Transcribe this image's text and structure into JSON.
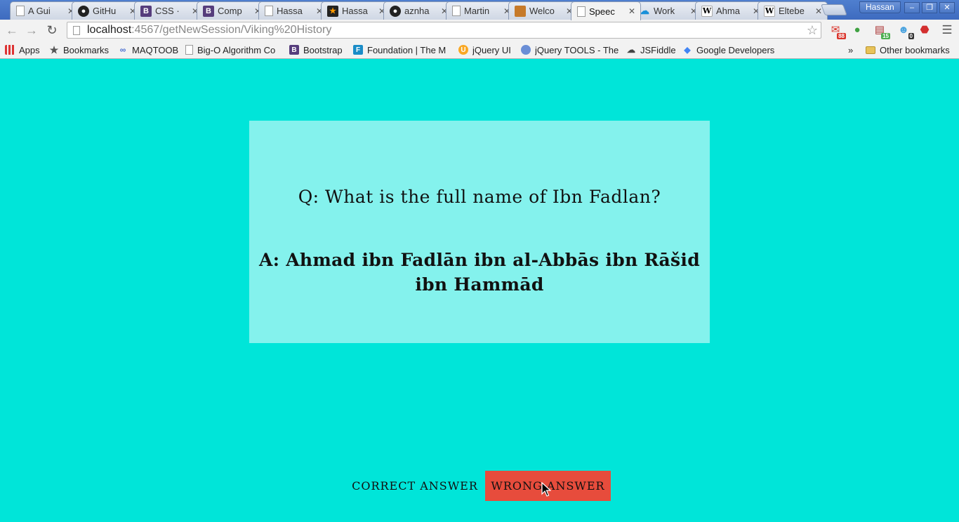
{
  "browser": {
    "tabs": [
      {
        "title": "A Gui",
        "favicon": "document-icon"
      },
      {
        "title": "GitHu",
        "favicon": "github-icon"
      },
      {
        "title": "CSS ·",
        "favicon": "bootstrap-icon"
      },
      {
        "title": "Comp",
        "favicon": "bootstrap-icon"
      },
      {
        "title": "Hassa",
        "favicon": "document-icon"
      },
      {
        "title": "Hassa",
        "favicon": "star-icon"
      },
      {
        "title": "aznha",
        "favicon": "github-icon"
      },
      {
        "title": "Martin",
        "favicon": "document-icon"
      },
      {
        "title": "Welco",
        "favicon": "box-icon"
      },
      {
        "title": "Speec",
        "favicon": "document-icon",
        "active": true
      },
      {
        "title": "Work",
        "favicon": "cloud-icon"
      },
      {
        "title": "Ahma",
        "favicon": "wikipedia-icon"
      },
      {
        "title": "Eltebe",
        "favicon": "wikipedia-icon"
      }
    ],
    "profile_name": "Hassan",
    "window_controls": {
      "minimize": "–",
      "restore": "❐",
      "close": "✕"
    },
    "url": {
      "host": "localhost",
      "path": ":4567/getNewSession/Viking%20History"
    },
    "extensions": [
      {
        "name": "gmail-icon",
        "badge": "88",
        "badge_color": "#d9342b"
      },
      {
        "name": "evernote-icon",
        "badge": ""
      },
      {
        "name": "calendar-icon",
        "badge": "15",
        "badge_color": "#4caf50"
      },
      {
        "name": "ghostery-icon",
        "badge": "0",
        "badge_color": "#333333"
      },
      {
        "name": "adblock-icon",
        "badge": ""
      }
    ],
    "bookmarks": [
      {
        "label": "Apps",
        "icon": "apps-grid-icon"
      },
      {
        "label": "Bookmarks",
        "icon": "star-icon"
      },
      {
        "label": "MAQTOOB",
        "icon": "maqtoob-icon"
      },
      {
        "label": "Big-O Algorithm Co",
        "icon": "document-icon"
      },
      {
        "label": "Bootstrap",
        "icon": "bootstrap-icon"
      },
      {
        "label": "Foundation | The M",
        "icon": "foundation-icon"
      },
      {
        "label": "jQuery UI",
        "icon": "jquery-ui-icon"
      },
      {
        "label": "jQuery TOOLS - The",
        "icon": "globe-icon"
      },
      {
        "label": "JSFiddle",
        "icon": "jsfiddle-icon"
      },
      {
        "label": "Google Developers",
        "icon": "google-icon"
      }
    ],
    "bookmarks_overflow": "»",
    "other_bookmarks": "Other bookmarks"
  },
  "flashcard": {
    "question": "Q: What is the full name of Ibn Fadlan?",
    "answer": "A: Ahmad ibn Fadlān ibn al-Abbās ibn Rāšid ibn Hammād"
  },
  "actions": {
    "correct_label": "CORRECT ANSWER",
    "wrong_label": "WRONG ANSWER"
  },
  "colors": {
    "page_background": "#00e5d9",
    "card_background": "#84f2ed",
    "wrong_button": "#e74c3c"
  }
}
